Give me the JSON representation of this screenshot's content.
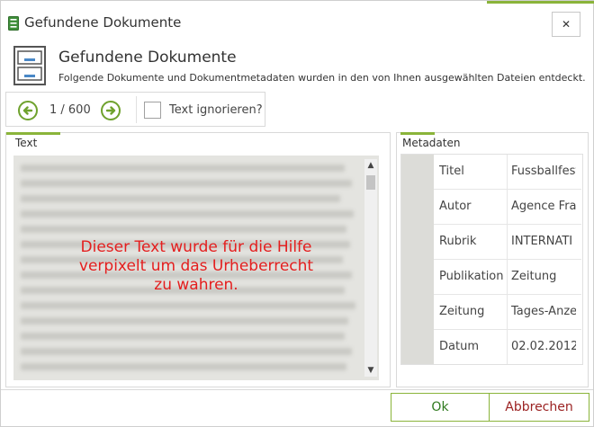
{
  "window": {
    "title": "Gefundene Dokumente",
    "close_glyph": "✕"
  },
  "header": {
    "title": "Gefundene Dokumente",
    "description": "Folgende Dokumente und Dokumentmetadaten wurden in den von Ihnen ausgewählten Dateien entdeckt."
  },
  "navigation": {
    "counter": "1 / 600",
    "ignore_text_label": "Text ignorieren?",
    "ignore_text_checked": false
  },
  "text_panel": {
    "label": "Text",
    "overlay": "Dieser Text wurde für die Hilfe\nverpixelt um das Urheberrecht\nzu wahren."
  },
  "metadata_panel": {
    "label": "Metadaten",
    "rows": [
      {
        "label": "Titel",
        "value": "Fussballfest"
      },
      {
        "label": "Autor",
        "value": "Agence Fra"
      },
      {
        "label": "Rubrik",
        "value": "INTERNATI"
      },
      {
        "label": "Publikation",
        "value": "Zeitung"
      },
      {
        "label": "Zeitung",
        "value": "Tages-Anze"
      },
      {
        "label": "Datum",
        "value": "02.02.2012"
      }
    ]
  },
  "buttons": {
    "ok": "Ok",
    "cancel": "Abbrechen"
  },
  "colors": {
    "accent": "#8ab43a",
    "overlay_text": "#e41e1e",
    "cancel_text": "#9b2222",
    "ok_text": "#2f7a1e"
  },
  "icons": {
    "app": "document-cabinet-icon",
    "header": "filing-cabinet-icon",
    "prev": "arrow-left-circle-icon",
    "next": "arrow-right-circle-icon",
    "close": "close-icon"
  }
}
